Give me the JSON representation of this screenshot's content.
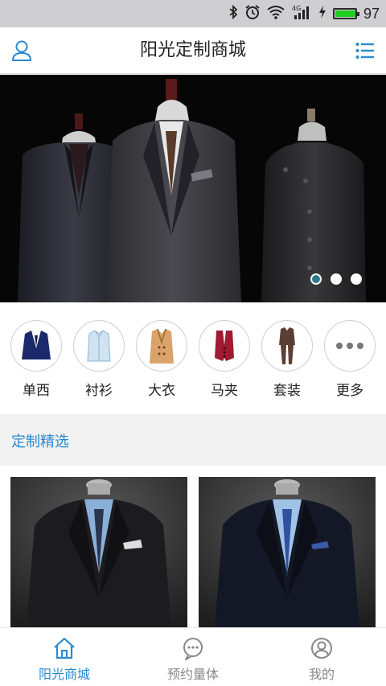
{
  "status_bar": {
    "network_label": "4G",
    "battery_level": "97",
    "battery_fraction": 0.97,
    "icons": [
      "bluetooth-icon",
      "alarm-icon",
      "wifi-icon",
      "signal-icon",
      "charging-icon",
      "battery-icon"
    ]
  },
  "header": {
    "title": "阳光定制商城",
    "left_icon": "user-icon",
    "right_icon": "list-menu-icon"
  },
  "banner": {
    "slides": 3,
    "active_slide": 1
  },
  "categories": [
    {
      "label": "单西",
      "icon": "blazer-icon"
    },
    {
      "label": "衬衫",
      "icon": "shirt-icon"
    },
    {
      "label": "大衣",
      "icon": "coat-icon"
    },
    {
      "label": "马夹",
      "icon": "vest-icon"
    },
    {
      "label": "套装",
      "icon": "suit-icon"
    },
    {
      "label": "更多",
      "icon": "more-icon"
    }
  ],
  "section": {
    "title": "定制精选"
  },
  "tabs": [
    {
      "label": "阳光商城",
      "icon": "home-icon",
      "active": true
    },
    {
      "label": "预约量体",
      "icon": "chat-icon",
      "active": false
    },
    {
      "label": "我的",
      "icon": "profile-icon",
      "active": false
    }
  ],
  "colors": {
    "accent": "#2a8ad0",
    "statusbar": "#cfcfd1",
    "battery": "#1fcc22"
  }
}
